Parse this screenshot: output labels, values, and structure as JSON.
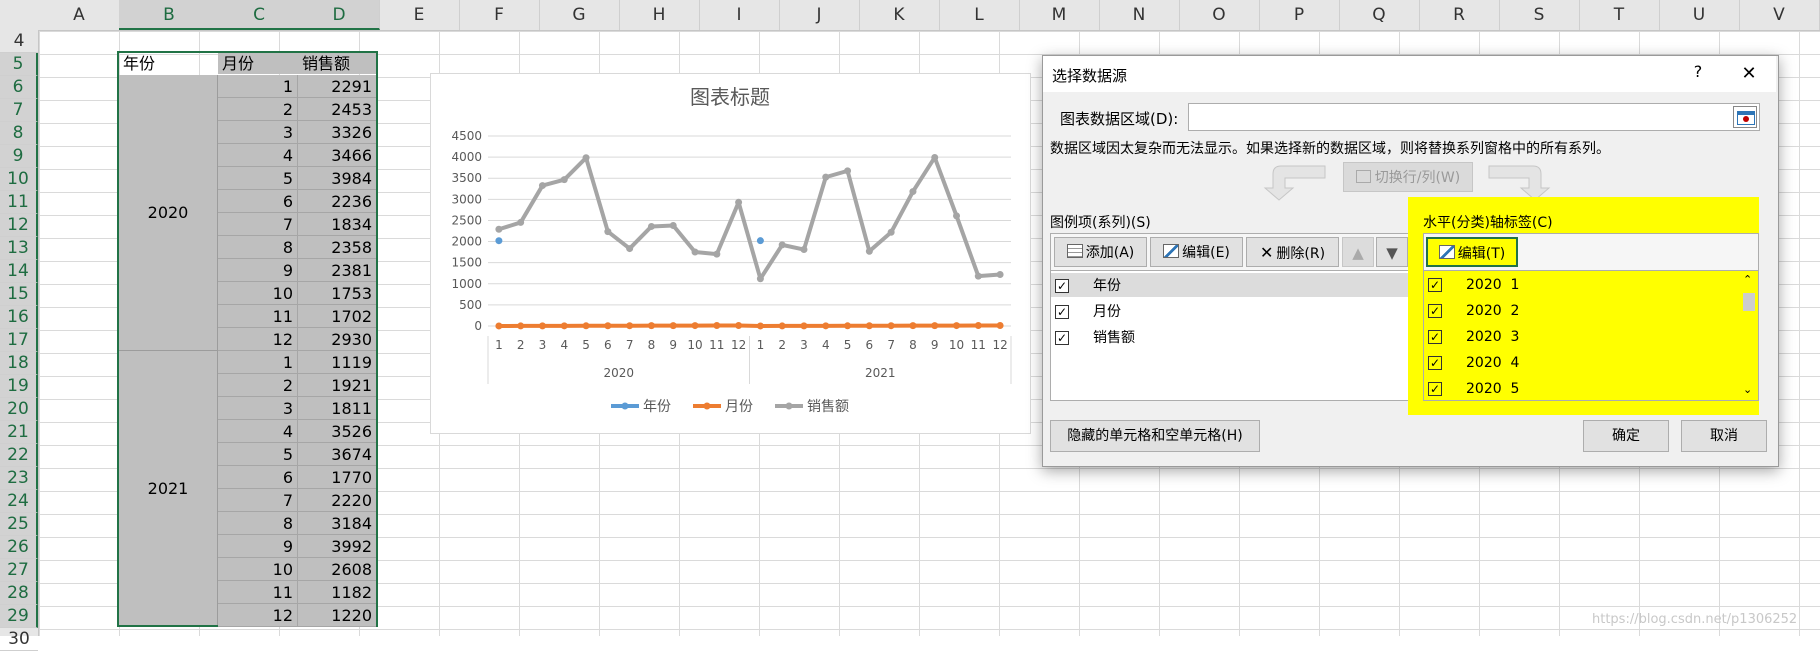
{
  "columns": [
    "A",
    "B",
    "C",
    "D",
    "E",
    "F",
    "G",
    "H",
    "I",
    "J",
    "K",
    "L",
    "M",
    "N",
    "O",
    "P",
    "Q",
    "R",
    "S",
    "T",
    "U",
    "V"
  ],
  "rows": [
    "4",
    "5",
    "6",
    "7",
    "8",
    "9",
    "10",
    "11",
    "12",
    "13",
    "14",
    "15",
    "16",
    "17",
    "18",
    "19",
    "20",
    "21",
    "22",
    "23",
    "24",
    "25",
    "26",
    "27",
    "28",
    "29",
    "30"
  ],
  "table": {
    "headers": {
      "year": "年份",
      "month": "月份",
      "sales": "销售额"
    },
    "year_2020": "2020",
    "year_2021": "2021",
    "months": [
      "1",
      "2",
      "3",
      "4",
      "5",
      "6",
      "7",
      "8",
      "9",
      "10",
      "11",
      "12",
      "1",
      "2",
      "3",
      "4",
      "5",
      "6",
      "7",
      "8",
      "9",
      "10",
      "11",
      "12"
    ],
    "sales": [
      "2291",
      "2453",
      "3326",
      "3466",
      "3984",
      "2236",
      "1834",
      "2358",
      "2381",
      "1753",
      "1702",
      "2930",
      "1119",
      "1921",
      "1811",
      "3526",
      "3674",
      "1770",
      "2220",
      "3184",
      "3992",
      "2608",
      "1182",
      "1220"
    ]
  },
  "chart_data": {
    "type": "line",
    "title": "图表标题",
    "categories": [
      "1",
      "2",
      "3",
      "4",
      "5",
      "6",
      "7",
      "8",
      "9",
      "10",
      "11",
      "12",
      "1",
      "2",
      "3",
      "4",
      "5",
      "6",
      "7",
      "8",
      "9",
      "10",
      "11",
      "12"
    ],
    "category_groups": [
      "2020",
      "2021"
    ],
    "ylim": [
      0,
      4500
    ],
    "yticks": [
      "0",
      "500",
      "1000",
      "1500",
      "2000",
      "2500",
      "3000",
      "3500",
      "4000",
      "4500"
    ],
    "series": [
      {
        "name": "年份",
        "color": "#5b9bd5",
        "points": [
          {
            "x": 1,
            "y": 2020
          },
          {
            "x": 13,
            "y": 2021
          }
        ]
      },
      {
        "name": "月份",
        "color": "#ed7d31",
        "values": [
          1,
          2,
          3,
          4,
          5,
          6,
          7,
          8,
          9,
          10,
          11,
          12,
          1,
          2,
          3,
          4,
          5,
          6,
          7,
          8,
          9,
          10,
          11,
          12
        ]
      },
      {
        "name": "销售额",
        "color": "#a5a5a5",
        "values": [
          2291,
          2453,
          3326,
          3466,
          3984,
          2236,
          1834,
          2358,
          2381,
          1753,
          1702,
          2930,
          1119,
          1921,
          1811,
          3526,
          3674,
          1770,
          2220,
          3184,
          3992,
          2608,
          1182,
          1220
        ]
      }
    ],
    "legend": "bottom"
  },
  "dialog": {
    "title": "选择数据源",
    "help": "?",
    "close": "✕",
    "range_label": "图表数据区域(D):",
    "range_value": "",
    "warning": "数据区域因太复杂而无法显示。如果选择新的数据区域，则将替换系列窗格中的所有系列。",
    "switch_label": "切换行/列(W)",
    "legend_label": "图例项(系列)(S)",
    "add": "添加(A)",
    "edit": "编辑(E)",
    "delete": "删除(R)",
    "series_items": [
      "年份",
      "月份",
      "销售额"
    ],
    "axis_label": "水平(分类)轴标签(C)",
    "axis_edit": "编辑(T)",
    "axis_items": [
      "2020  1",
      "2020  2",
      "2020  3",
      "2020  4",
      "2020  5"
    ],
    "hidden_cells": "隐藏的单元格和空单元格(H)",
    "ok": "确定",
    "cancel": "取消"
  },
  "watermark": "https://blog.csdn.net/p1306252"
}
